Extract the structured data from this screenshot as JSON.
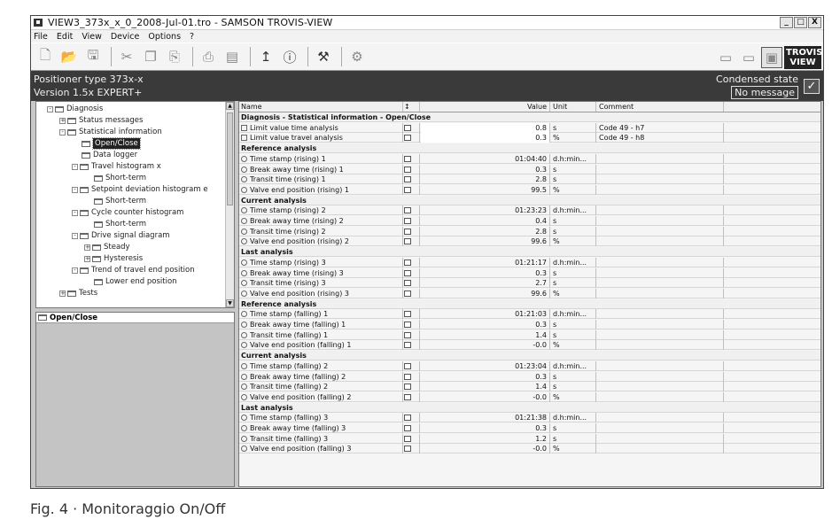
{
  "window": {
    "title": "VIEW3_373x_x_0_2008-Jul-01.tro - SAMSON TROVIS-VIEW",
    "buttons": {
      "minimize": "_",
      "maximize": "□",
      "close": "X"
    }
  },
  "menu": [
    "File",
    "Edit",
    "View",
    "Device",
    "Options",
    "?"
  ],
  "toolbar": {
    "left_icons": [
      "new-file-icon",
      "open-file-icon",
      "save-icon",
      "cut-icon",
      "copy-icon",
      "paste-icon",
      "print-icon",
      "print-preview-icon",
      "upload-icon",
      "help-icon",
      "wrench-icon",
      "device-settings-icon"
    ],
    "right_icons": [
      "offline-icon",
      "online-icon",
      "condensed-state-icon"
    ],
    "logo_line1": "TROVIS",
    "logo_line2": "VIEW"
  },
  "info": {
    "line1": "Positioner type 373x-x",
    "line2": "Version 1.5x EXPERT+",
    "state_label": "Condensed state",
    "state_message": "No message"
  },
  "tree": [
    {
      "label": "Diagnosis",
      "level": 0,
      "exp": "-"
    },
    {
      "label": "Status messages",
      "level": 1,
      "exp": "+"
    },
    {
      "label": "Statistical information",
      "level": 1,
      "exp": "-"
    },
    {
      "label": "Open/Close",
      "level": 2,
      "exp": "",
      "selected": true
    },
    {
      "label": "Data logger",
      "level": 2,
      "exp": ""
    },
    {
      "label": "Travel histogram x",
      "level": 2,
      "exp": "-"
    },
    {
      "label": "Short-term",
      "level": 3,
      "exp": ""
    },
    {
      "label": "Setpoint deviation histogram e",
      "level": 2,
      "exp": "-"
    },
    {
      "label": "Short-term",
      "level": 3,
      "exp": ""
    },
    {
      "label": "Cycle counter histogram",
      "level": 2,
      "exp": "-"
    },
    {
      "label": "Short-term",
      "level": 3,
      "exp": ""
    },
    {
      "label": "Drive signal diagram",
      "level": 2,
      "exp": "-"
    },
    {
      "label": "Steady",
      "level": 3,
      "exp": "+"
    },
    {
      "label": "Hysteresis",
      "level": 3,
      "exp": "+"
    },
    {
      "label": "Trend of travel end position",
      "level": 2,
      "exp": "-"
    },
    {
      "label": "Lower end position",
      "level": 3,
      "exp": ""
    },
    {
      "label": "Tests",
      "level": 1,
      "exp": "+"
    }
  ],
  "detail": {
    "title": "Open/Close"
  },
  "grid": {
    "headers": {
      "name": "Name",
      "flag": "↕",
      "value": "Value",
      "unit": "Unit",
      "comment": "Comment"
    },
    "rows": [
      {
        "type": "section",
        "name": "Diagnosis - Statistical information - Open/Close"
      },
      {
        "type": "row",
        "icon": "sq",
        "name": "Limit value time analysis",
        "value": "0.8",
        "unit": "s",
        "comment": "Code 49 - h7",
        "hl": true
      },
      {
        "type": "row",
        "icon": "sq",
        "name": "Limit value travel analysis",
        "value": "0.3",
        "unit": "%",
        "comment": "Code 49 - h8",
        "hl": true
      },
      {
        "type": "section",
        "name": "Reference analysis"
      },
      {
        "type": "row",
        "name": "Time stamp (rising) 1",
        "value": "01:04:40",
        "unit": "d.h:min...",
        "comment": ""
      },
      {
        "type": "row",
        "name": "Break away time (rising) 1",
        "value": "0.3",
        "unit": "s",
        "comment": ""
      },
      {
        "type": "row",
        "name": "Transit time (rising) 1",
        "value": "2.8",
        "unit": "s",
        "comment": ""
      },
      {
        "type": "row",
        "name": "Valve end position (rising) 1",
        "value": "99.5",
        "unit": "%",
        "comment": ""
      },
      {
        "type": "section",
        "name": "Current analysis"
      },
      {
        "type": "row",
        "name": "Time stamp (rising) 2",
        "value": "01:23:23",
        "unit": "d.h:min...",
        "comment": ""
      },
      {
        "type": "row",
        "name": "Break away time (rising) 2",
        "value": "0.4",
        "unit": "s",
        "comment": ""
      },
      {
        "type": "row",
        "name": "Transit time (rising) 2",
        "value": "2.8",
        "unit": "s",
        "comment": ""
      },
      {
        "type": "row",
        "name": "Valve end position (rising) 2",
        "value": "99.6",
        "unit": "%",
        "comment": ""
      },
      {
        "type": "section",
        "name": "Last analysis"
      },
      {
        "type": "row",
        "name": "Time stamp (rising) 3",
        "value": "01:21:17",
        "unit": "d.h:min...",
        "comment": ""
      },
      {
        "type": "row",
        "name": "Break away time (rising) 3",
        "value": "0.3",
        "unit": "s",
        "comment": ""
      },
      {
        "type": "row",
        "name": "Transit time (rising) 3",
        "value": "2.7",
        "unit": "s",
        "comment": ""
      },
      {
        "type": "row",
        "name": "Valve end position (rising) 3",
        "value": "99.6",
        "unit": "%",
        "comment": ""
      },
      {
        "type": "section",
        "name": "Reference analysis"
      },
      {
        "type": "row",
        "name": "Time stamp (falling) 1",
        "value": "01:21:03",
        "unit": "d.h:min...",
        "comment": ""
      },
      {
        "type": "row",
        "name": "Break away time (falling) 1",
        "value": "0.3",
        "unit": "s",
        "comment": ""
      },
      {
        "type": "row",
        "name": "Transit time (falling) 1",
        "value": "1.4",
        "unit": "s",
        "comment": ""
      },
      {
        "type": "row",
        "name": "Valve end position (falling) 1",
        "value": "-0.0",
        "unit": "%",
        "comment": ""
      },
      {
        "type": "section",
        "name": "Current analysis"
      },
      {
        "type": "row",
        "name": "Time stamp (falling) 2",
        "value": "01:23:04",
        "unit": "d.h:min...",
        "comment": ""
      },
      {
        "type": "row",
        "name": "Break away time (falling) 2",
        "value": "0.3",
        "unit": "s",
        "comment": ""
      },
      {
        "type": "row",
        "name": "Transit time (falling) 2",
        "value": "1.4",
        "unit": "s",
        "comment": ""
      },
      {
        "type": "row",
        "name": "Valve end position (falling) 2",
        "value": "-0.0",
        "unit": "%",
        "comment": ""
      },
      {
        "type": "section",
        "name": "Last analysis"
      },
      {
        "type": "row",
        "name": "Time stamp (falling) 3",
        "value": "01:21:38",
        "unit": "d.h:min...",
        "comment": ""
      },
      {
        "type": "row",
        "name": "Break away time (falling) 3",
        "value": "0.3",
        "unit": "s",
        "comment": ""
      },
      {
        "type": "row",
        "name": "Transit time (falling) 3",
        "value": "1.2",
        "unit": "s",
        "comment": ""
      },
      {
        "type": "row",
        "name": "Valve end position (falling) 3",
        "value": "-0.0",
        "unit": "%",
        "comment": ""
      }
    ]
  },
  "caption": "Fig. 4 · Monitoraggio On/Off"
}
